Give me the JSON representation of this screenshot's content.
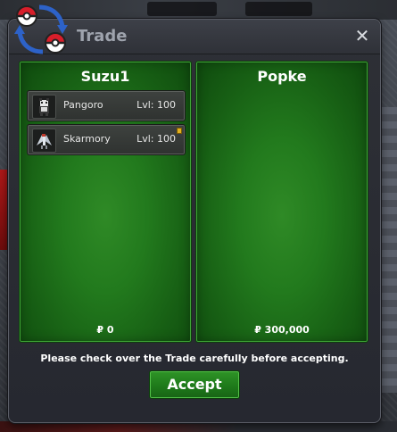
{
  "window": {
    "title": "Trade",
    "close_label": "✕"
  },
  "left_panel": {
    "player": "Suzu1",
    "pokemon": [
      {
        "name": "Pangoro",
        "level": "Lvl: 100",
        "held_item": false
      },
      {
        "name": "Skarmory",
        "level": "Lvl: 100",
        "held_item": true
      }
    ],
    "money": "₽ 0"
  },
  "right_panel": {
    "player": "Popke",
    "pokemon": [],
    "money": "₽ 300,000"
  },
  "notice": "Please check over the Trade carefully before accepting.",
  "accept_label": "Accept",
  "colors": {
    "panel_green": "#227a1d",
    "accept_green": "#1e7a1a",
    "window_bg": "#2b2d33",
    "title_text": "#9ea3ad"
  }
}
